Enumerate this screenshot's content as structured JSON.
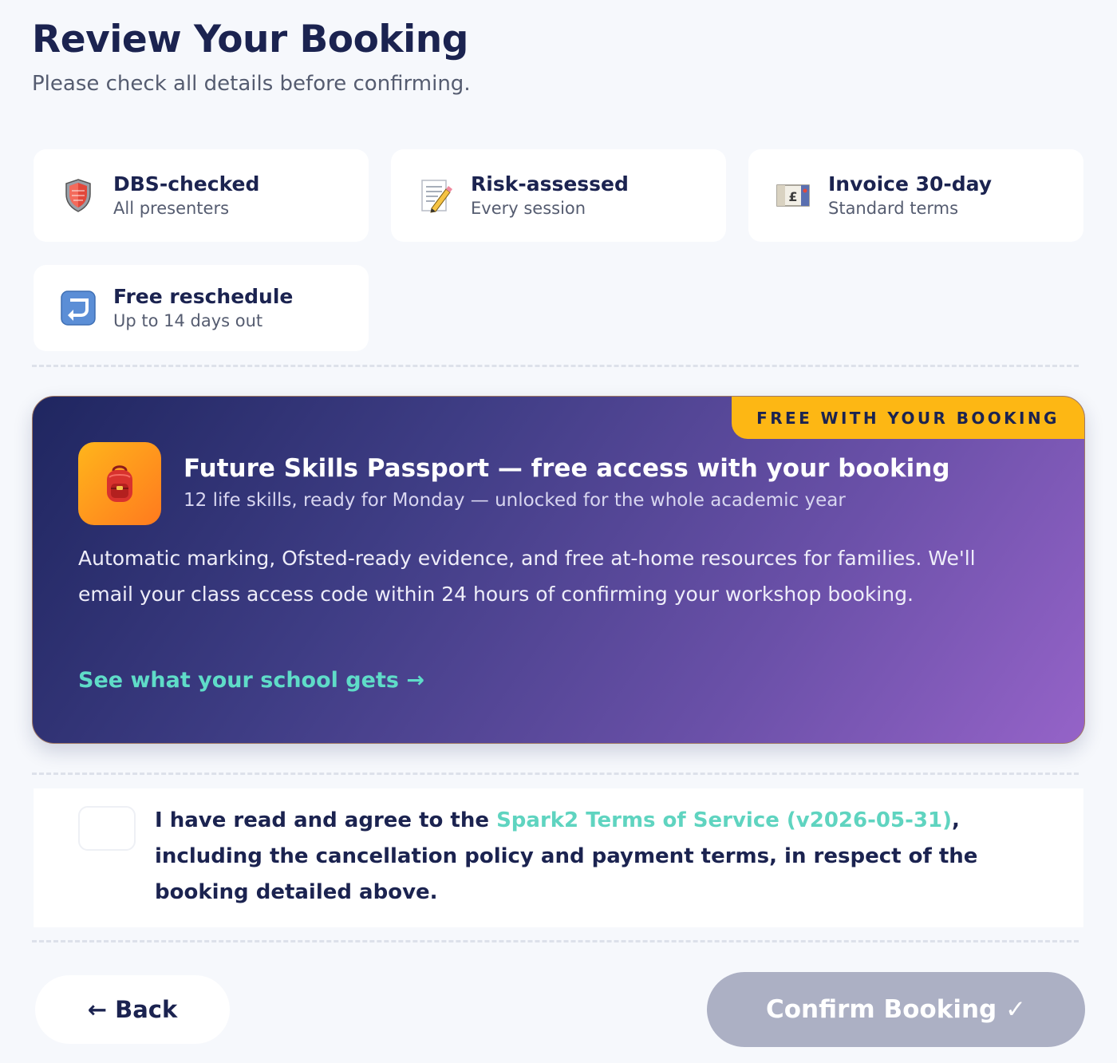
{
  "header": {
    "title": "Review Your Booking",
    "subtitle": "Please check all details before confirming."
  },
  "features": [
    {
      "icon": "shield-icon",
      "title": "DBS-checked",
      "subtitle": "All presenters"
    },
    {
      "icon": "memo-pencil-icon",
      "title": "Risk-assessed",
      "subtitle": "Every session"
    },
    {
      "icon": "pound-banknote-icon",
      "title": "Invoice 30-day",
      "subtitle": "Standard terms"
    },
    {
      "icon": "return-arrow-icon",
      "title": "Free reschedule",
      "subtitle": "Up to 14 days out"
    }
  ],
  "promo": {
    "ribbon": "FREE WITH YOUR BOOKING",
    "icon": "backpack-icon",
    "title": "Future Skills Passport — free access with your booking",
    "subtitle": "12 life skills, ready for Monday — unlocked for the whole academic year",
    "body": "Automatic marking, Ofsted-ready evidence, and free at-home resources for families. We'll email your class access code within 24 hours of confirming your workshop booking.",
    "link": "See what your school gets →"
  },
  "terms": {
    "checked": false,
    "prefix": "I have read and agree to the ",
    "link": "Spark2 Terms of Service (v2026-05-31)",
    "suffix": ", including the cancellation policy and payment terms, in respect of the booking detailed above."
  },
  "footer": {
    "back_label": "← Back",
    "confirm_label": "Confirm Booking ✓"
  },
  "colors": {
    "navy": "#1b2350",
    "accent_teal": "#5fdcc8",
    "ribbon_yellow": "#fdb714",
    "confirm_disabled": "#acb0c4"
  }
}
